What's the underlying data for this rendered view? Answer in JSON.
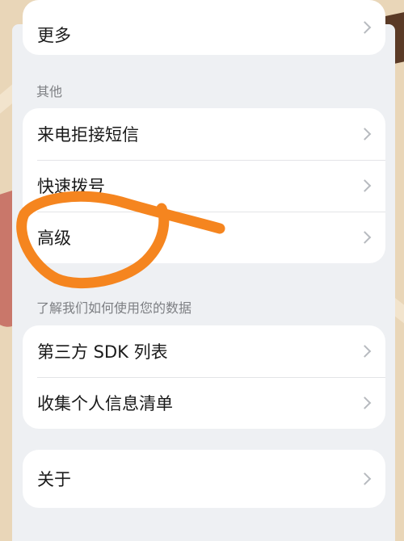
{
  "top_card": {
    "partial_item_label": "更多"
  },
  "section_other": {
    "title": "其他",
    "items": [
      {
        "label": "来电拒接短信"
      },
      {
        "label": "快速拨号"
      },
      {
        "label": "高级"
      }
    ]
  },
  "section_data": {
    "title": "了解我们如何使用您的数据",
    "items": [
      {
        "label": "第三方 SDK 列表"
      },
      {
        "label": "收集个人信息清单"
      }
    ]
  },
  "section_about": {
    "items": [
      {
        "label": "关于"
      }
    ]
  },
  "colors": {
    "annotation_stroke": "#f5851f",
    "card_background": "#ffffff",
    "screen_background": "#eef0f3"
  },
  "icons": {
    "corner": [
      "arrow-circle-icon",
      "arrow-circle-icon"
    ],
    "row_trailing": "chevron-right-icon"
  }
}
